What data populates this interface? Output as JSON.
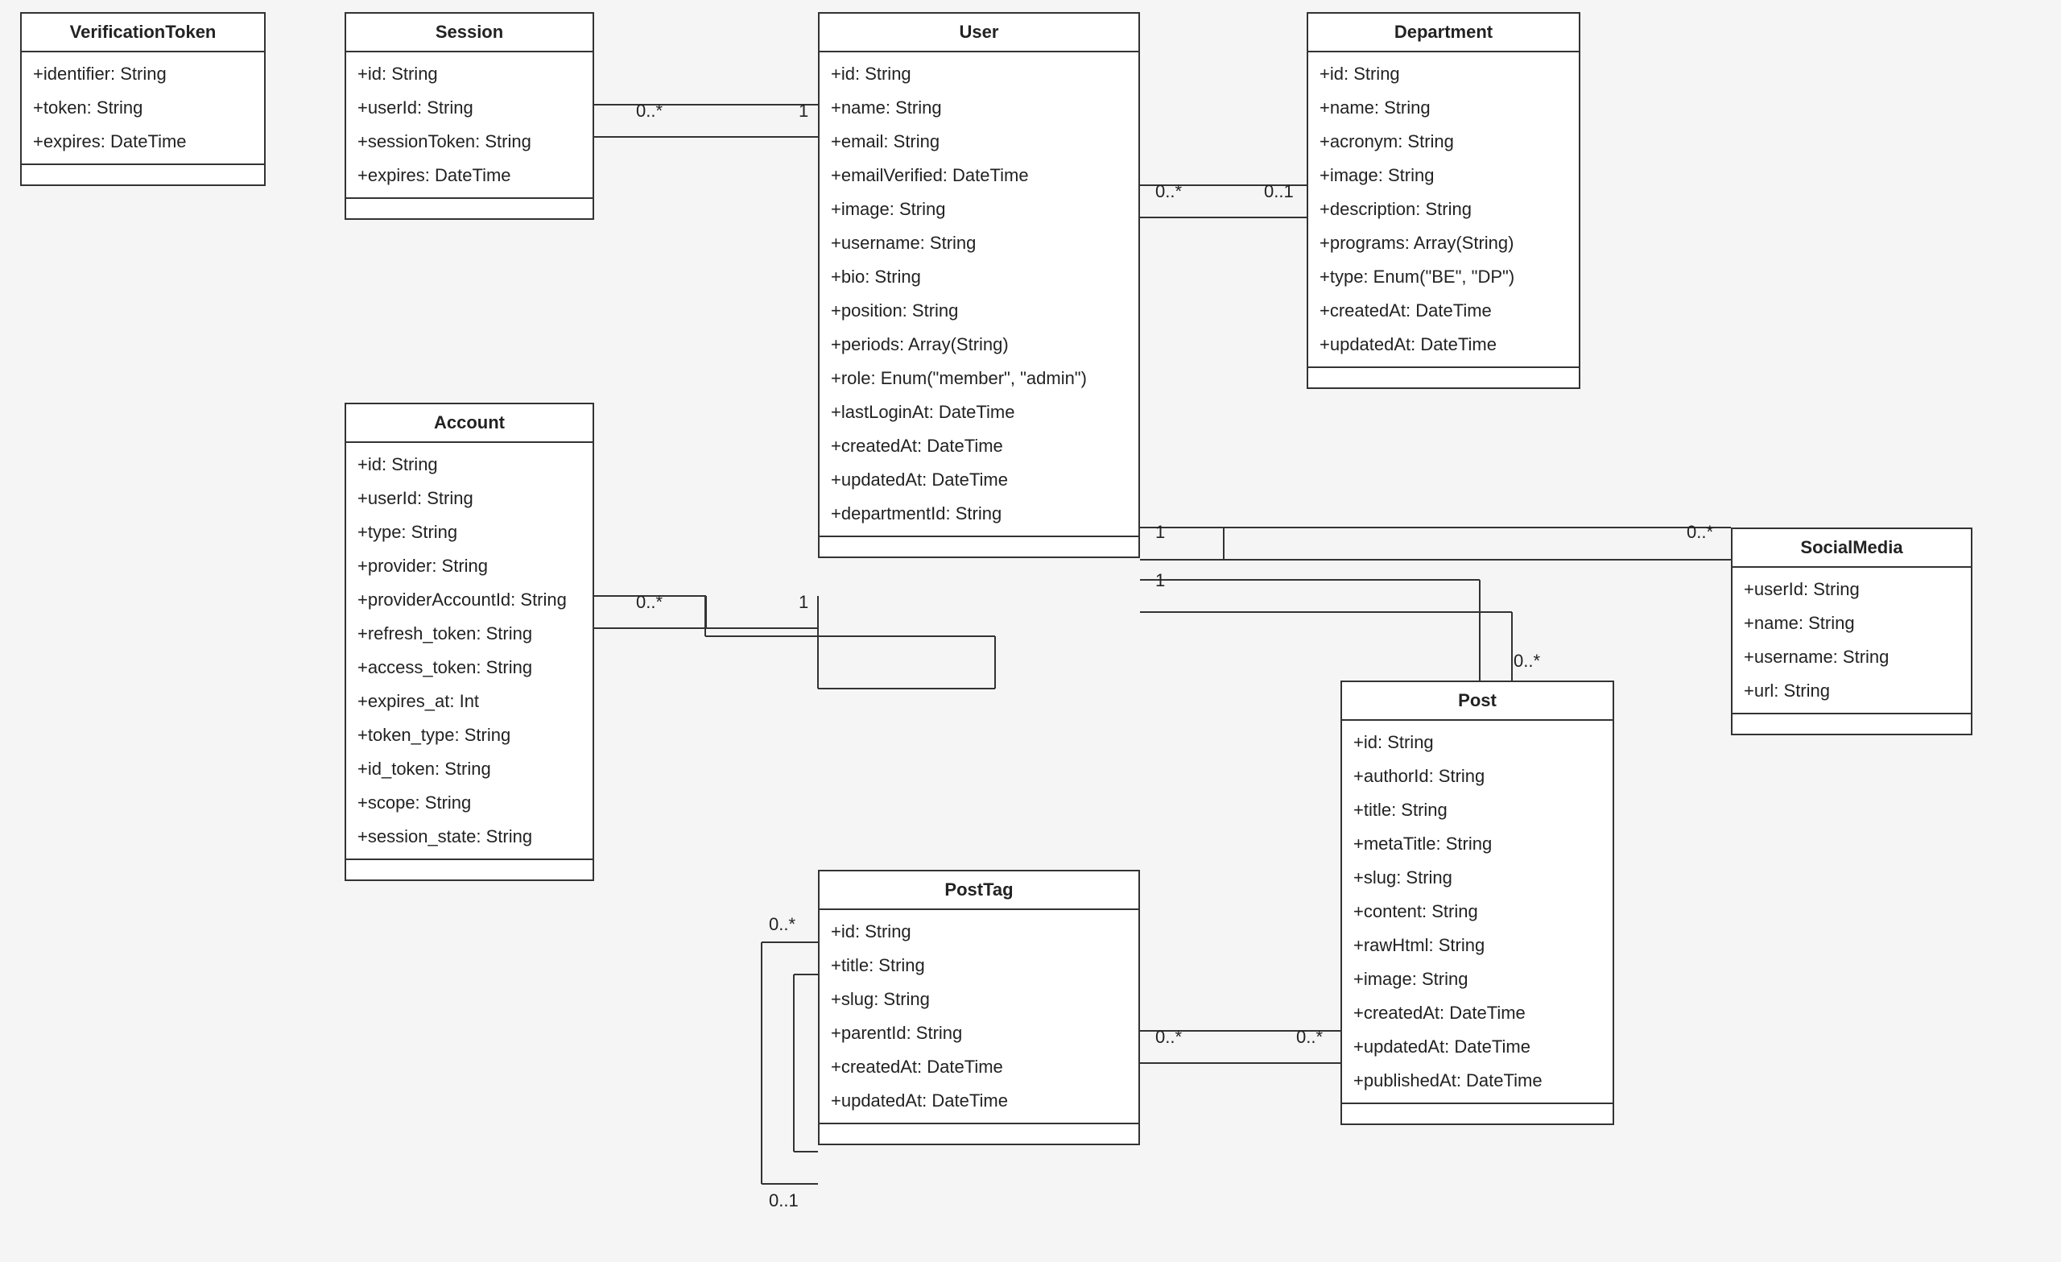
{
  "entities": {
    "verificationToken": {
      "title": "VerificationToken",
      "attrs": [
        "+identifier: String",
        "+token: String",
        "+expires: DateTime"
      ]
    },
    "session": {
      "title": "Session",
      "attrs": [
        "+id: String",
        "+userId: String",
        "+sessionToken: String",
        "+expires: DateTime"
      ]
    },
    "user": {
      "title": "User",
      "attrs": [
        "+id: String",
        "+name: String",
        "+email: String",
        "+emailVerified: DateTime",
        "+image: String",
        "+username: String",
        "+bio: String",
        "+position: String",
        "+periods: Array(String)",
        "+role: Enum(\"member\", \"admin\")",
        "+lastLoginAt: DateTime",
        "+createdAt: DateTime",
        "+updatedAt: DateTime",
        "+departmentId: String"
      ]
    },
    "department": {
      "title": "Department",
      "attrs": [
        "+id: String",
        "+name: String",
        "+acronym: String",
        "+image: String",
        "+description: String",
        "+programs: Array(String)",
        "+type: Enum(\"BE\", \"DP\")",
        "+createdAt: DateTime",
        "+updatedAt: DateTime"
      ]
    },
    "account": {
      "title": "Account",
      "attrs": [
        "+id: String",
        "+userId: String",
        "+type: String",
        "+provider: String",
        "+providerAccountId: String",
        "+refresh_token: String",
        "+access_token: String",
        "+expires_at: Int",
        "+token_type: String",
        "+id_token: String",
        "+scope: String",
        "+session_state: String"
      ]
    },
    "postTag": {
      "title": "PostTag",
      "attrs": [
        "+id: String",
        "+title: String",
        "+slug: String",
        "+parentId: String",
        "+createdAt: DateTime",
        "+updatedAt: DateTime"
      ]
    },
    "post": {
      "title": "Post",
      "attrs": [
        "+id: String",
        "+authorId: String",
        "+title: String",
        "+metaTitle: String",
        "+slug: String",
        "+content: String",
        "+rawHtml: String",
        "+image: String",
        "+createdAt: DateTime",
        "+updatedAt: DateTime",
        "+publishedAt: DateTime"
      ]
    },
    "socialMedia": {
      "title": "SocialMedia",
      "attrs": [
        "+userId: String",
        "+name: String",
        "+username: String",
        "+url: String"
      ]
    }
  },
  "relLabels": {
    "sessionUserL": "0..*",
    "sessionUserR": "1",
    "accountUserL": "0..*",
    "accountUserR": "1",
    "userDeptL": "0..*",
    "userDeptR": "0..1",
    "userSocialL": "1",
    "userSocialR": "0..*",
    "userPostL": "1",
    "userPostR": "0..*",
    "postTagPostL": "0..*",
    "postTagPostR": "0..*",
    "postTagSelfTop": "0..*",
    "postTagSelfBottom": "0..1"
  }
}
